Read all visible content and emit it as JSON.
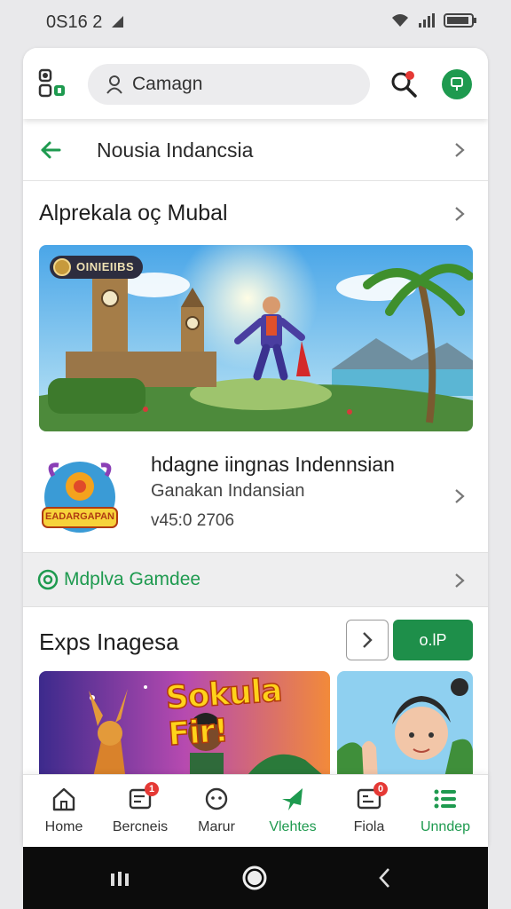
{
  "status_bar": {
    "time": "0S16 2"
  },
  "search": {
    "placeholder": "Camagn"
  },
  "nav_row": {
    "title": "Nousia Indancsia"
  },
  "featured": {
    "title": "Alprekala oç Mubal",
    "hero_badge": "OINIEIIBS"
  },
  "app": {
    "name": "hdagne iingnas Indennsian",
    "developer": "Ganakan Indansian",
    "version": "v45:0  2706",
    "icon_text": "EADARGAPAN"
  },
  "promo": {
    "label": "Mdplva Gamdee"
  },
  "explore": {
    "title": "Exps Inagesa",
    "get_label": "o.lP",
    "thumb1_caption": "Sokula Fir!"
  },
  "bottom_nav": [
    {
      "label": "Home",
      "icon": "home-icon",
      "badge": ""
    },
    {
      "label": "Bercneis",
      "icon": "games-icon",
      "badge": "1"
    },
    {
      "label": "Marur",
      "icon": "clock-icon",
      "badge": ""
    },
    {
      "label": "Vlehtes",
      "icon": "star-icon",
      "badge": ""
    },
    {
      "label": "Fiola",
      "icon": "apps-grid-icon",
      "badge": "0"
    },
    {
      "label": "Unndep",
      "icon": "menu-list-icon",
      "badge": ""
    }
  ],
  "colors": {
    "accent": "#1e9a4f",
    "badge": "#e53935"
  }
}
